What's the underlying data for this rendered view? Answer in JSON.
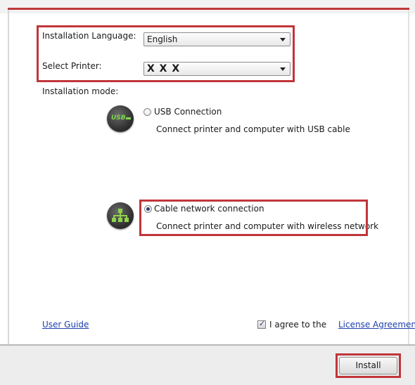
{
  "settings": {
    "language_label": "Installation Language:",
    "language_value": "English",
    "printer_label": "Select Printer:",
    "printer_value": "X X X"
  },
  "installation_mode": {
    "label": "Installation mode:",
    "options": [
      {
        "icon_text": "USB",
        "title": "USB Connection",
        "description": "Connect printer and computer with USB cable",
        "selected": false
      },
      {
        "title": "Cable network connection",
        "description": "Connect printer and computer with wireless network",
        "selected": true
      }
    ]
  },
  "footer_links": {
    "user_guide": "User Guide",
    "agree_text": "I agree to the",
    "license_link": "License Agreement",
    "agree_checked": true
  },
  "buttons": {
    "install": "Install"
  },
  "colors": {
    "highlight": "#c0363a",
    "link": "#1d3fae",
    "accent_bar": "#c0393a"
  }
}
